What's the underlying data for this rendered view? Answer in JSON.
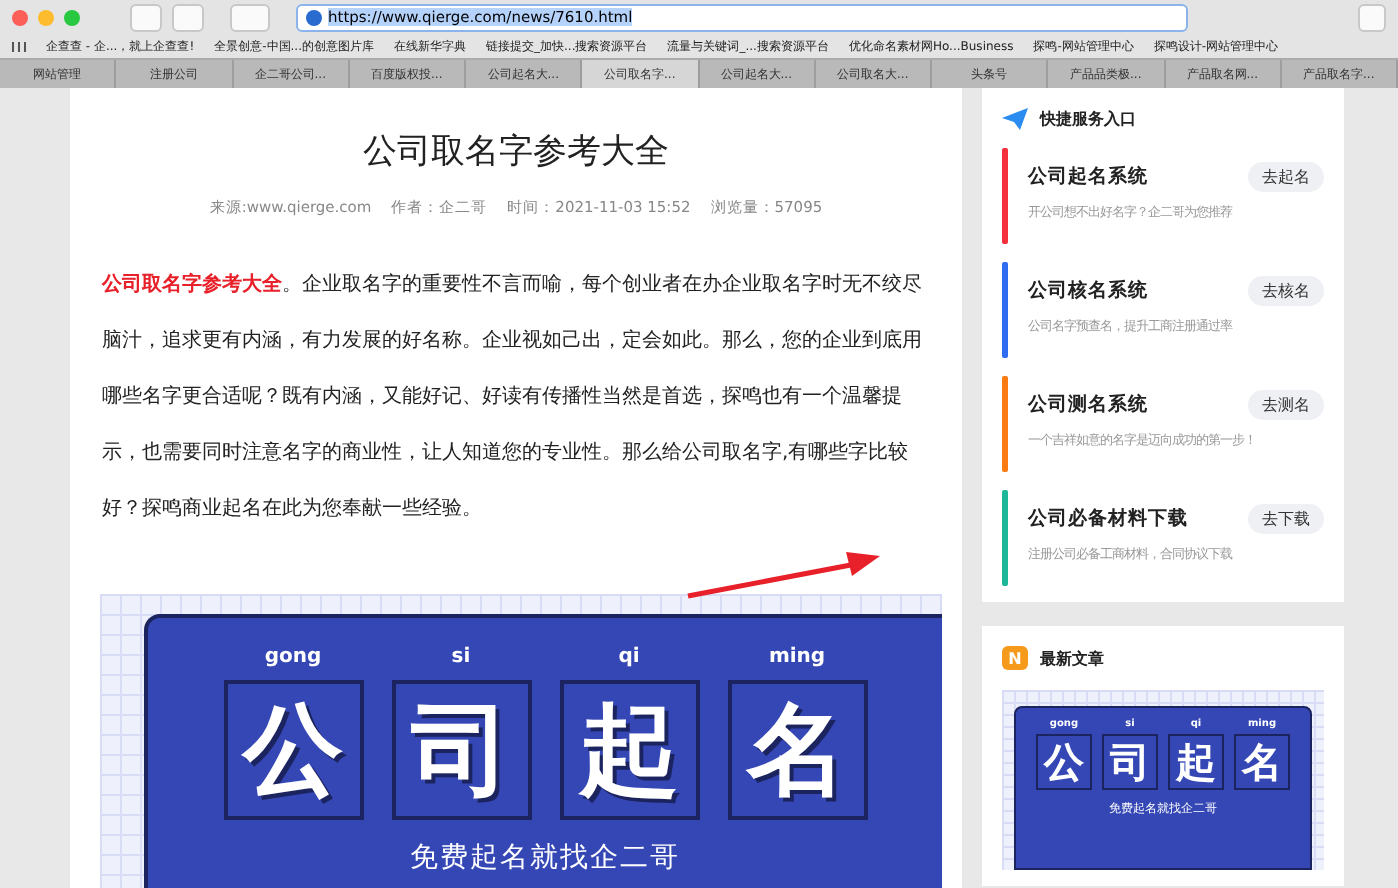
{
  "browser": {
    "url": "https://www.qierge.com/news/7610.html",
    "bookmarks": [
      "企查查 - 企...，就上企查查!",
      "全景创意-中国...的创意图片库",
      "在线新华字典",
      "链接提交_加快...搜索资源平台",
      "流量与关键词_...搜索资源平台",
      "优化命名素材网Ho...Business",
      "探鸣-网站管理中心",
      "探鸣设计-网站管理中心"
    ],
    "tabs": [
      {
        "label": "网站管理",
        "selected": false
      },
      {
        "label": "注册公司",
        "selected": false
      },
      {
        "label": "企二哥公司...",
        "selected": false
      },
      {
        "label": "百度版权投...",
        "selected": false
      },
      {
        "label": "公司起名大...",
        "selected": false
      },
      {
        "label": "公司取名字...",
        "selected": true
      },
      {
        "label": "公司起名大...",
        "selected": false
      },
      {
        "label": "公司取名大...",
        "selected": false
      },
      {
        "label": "头条号",
        "selected": false
      },
      {
        "label": "产品品类极...",
        "selected": false
      },
      {
        "label": "产品取名网...",
        "selected": false
      },
      {
        "label": "产品取名字...",
        "selected": false
      }
    ]
  },
  "article": {
    "title": "公司取名字参考大全",
    "meta": [
      "来源:www.qierge.com",
      "作者：企二哥",
      "时间：2021-11-03 15:52",
      "浏览量：57095"
    ],
    "lead": "公司取名字参考大全",
    "body": "。企业取名字的重要性不言而喻，每个创业者在办企业取名字时无不绞尽脑汁，追求更有内涵，有力发展的好名称。企业视如己出，定会如此。那么，您的企业到底用哪些名字更合适呢？既有内涵，又能好记、好读有传播性当然是首选，探鸣也有一个温馨提示，也需要同时注意名字的商业性，让人知道您的专业性。那么给公司取名字,有哪些字比较好？探鸣商业起名在此为您奉献一些经验。",
    "banner": {
      "pinyin": [
        "gong",
        "si",
        "qi",
        "ming"
      ],
      "characters": [
        "公",
        "司",
        "起",
        "名"
      ],
      "subtitle": "免费起名就找企二哥"
    }
  },
  "sidebar": {
    "title": "快捷服务入口",
    "services": [
      {
        "name": "公司起名系统",
        "button": "去起名",
        "description": "开公司想不出好名字？企二哥为您推荐",
        "color": "#f5303d"
      },
      {
        "name": "公司核名系统",
        "button": "去核名",
        "description": "公司名字预查名，提升工商注册通过率",
        "color": "#2f6cf0"
      },
      {
        "name": "公司测名系统",
        "button": "去测名",
        "description": "一个吉祥如意的名字是迈向成功的第一步！",
        "color": "#fa7a14"
      },
      {
        "name": "公司必备材料下载",
        "button": "去下载",
        "description": "注册公司必备工商材料，合同协议下载",
        "color": "#1fb79a"
      }
    ],
    "latest": {
      "badge": "N",
      "title": "最新文章",
      "thumbnail": {
        "pinyin": [
          "gong",
          "si",
          "qi",
          "ming"
        ],
        "characters": [
          "公",
          "司",
          "起",
          "名"
        ],
        "subtitle": "免费起名就找企二哥"
      }
    }
  }
}
